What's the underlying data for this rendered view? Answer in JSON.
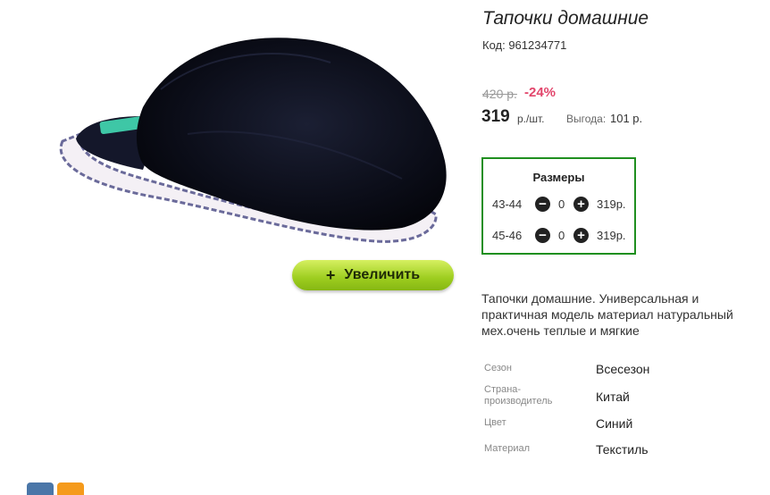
{
  "product": {
    "title": "Тапочки домашние",
    "code": "Код: 961234771",
    "old_price": "420 р.",
    "discount": "-24%",
    "price": "319",
    "unit": "р./шт.",
    "savings_label": "Выгода:",
    "savings_value": "101 р.",
    "zoom_label": "Увеличить",
    "description": "Тапочки домашние. Универсальная и практичная модель материал натуральный мех.очень теплые и мягкие"
  },
  "sizes": {
    "title": "Размеры",
    "rows": [
      {
        "label": "43-44",
        "qty": "0",
        "price": "319р."
      },
      {
        "label": "45-46",
        "qty": "0",
        "price": "319р."
      }
    ]
  },
  "specs": [
    {
      "key": "Сезон",
      "value": "Всесезон"
    },
    {
      "key": "Страна-производитель",
      "value": "Китай"
    },
    {
      "key": "Цвет",
      "value": "Синий"
    },
    {
      "key": "Материал",
      "value": "Текстиль"
    }
  ],
  "colors": {
    "accent_green": "#1f8f1f",
    "discount": "#e2456b",
    "button": "#9dcd1f"
  },
  "icons": {
    "minus": "minus-circle-icon",
    "plus": "plus-circle-icon"
  }
}
